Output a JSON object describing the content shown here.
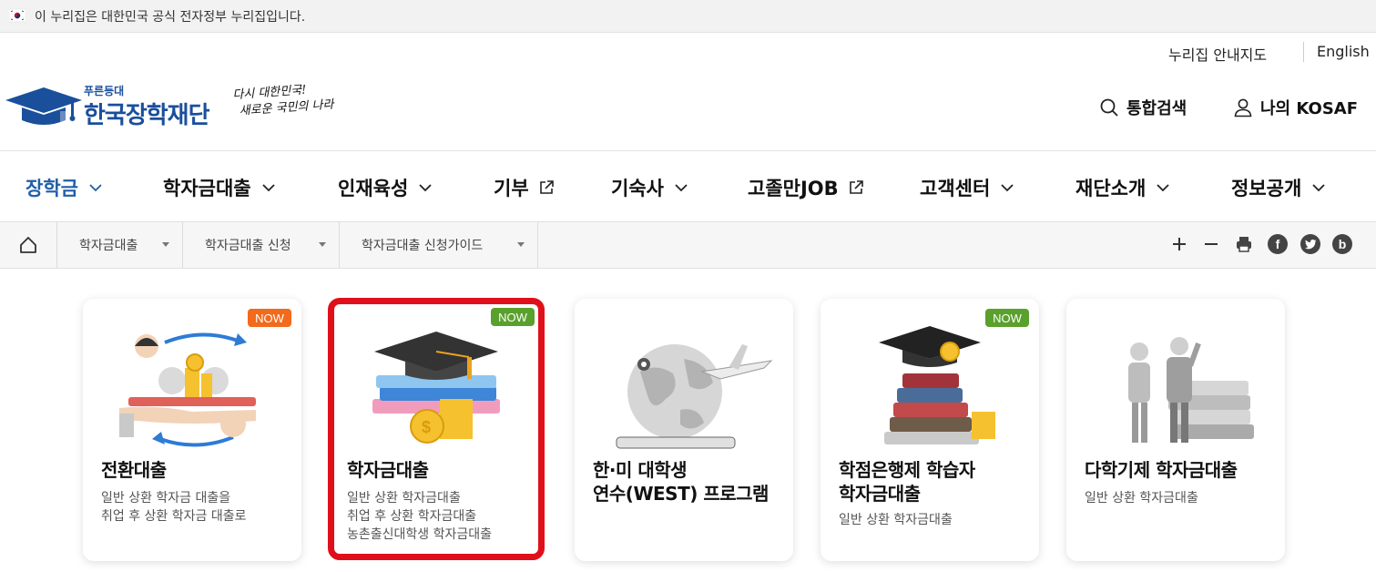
{
  "gov_banner": {
    "text": "이 누리집은 대한민국 공식 전자정부 누리집입니다."
  },
  "utility": {
    "sitemap": "누리집 안내지도",
    "english": "English"
  },
  "logo": {
    "pre": "푸른등대",
    "main": "한국장학재단"
  },
  "slogan": {
    "line1": "다시 대한민국!",
    "line2": "새로운 국민의 나라"
  },
  "header": {
    "search": "통합검색",
    "my": "나의 KOSAF"
  },
  "gnb": [
    {
      "label": "장학금",
      "icon": "chevron-down-icon",
      "active": true
    },
    {
      "label": "학자금대출",
      "icon": "chevron-down-icon"
    },
    {
      "label": "인재육성",
      "icon": "chevron-down-icon"
    },
    {
      "label": "기부",
      "icon": "external-link-icon"
    },
    {
      "label": "기숙사",
      "icon": "chevron-down-icon"
    },
    {
      "label": "고졸만JOB",
      "icon": "external-link-icon"
    },
    {
      "label": "고객센터",
      "icon": "chevron-down-icon"
    },
    {
      "label": "재단소개",
      "icon": "chevron-down-icon"
    },
    {
      "label": "정보공개",
      "icon": "chevron-down-icon"
    }
  ],
  "breadcrumb": [
    "학자금대출",
    "학자금대출 신청",
    "학자금대출 신청가이드"
  ],
  "tools": {
    "facebook": "f",
    "blog": "b"
  },
  "cards": [
    {
      "title": "전환대출",
      "desc": [
        "일반 상환 학자금 대출을",
        "취업 후 상환 학자금 대출로"
      ],
      "badge": "NOW",
      "badge_color": "#f26a1b"
    },
    {
      "title": "학자금대출",
      "desc": [
        "일반 상환 학자금대출",
        "취업 후 상환 학자금대출",
        "농촌출신대학생 학자금대출"
      ],
      "badge": "NOW",
      "badge_color": "#5aa02c",
      "selected": true
    },
    {
      "title": "한·미 대학생",
      "title2": "연수(WEST) 프로그램",
      "desc": []
    },
    {
      "title": "학점은행제 학습자",
      "title2": "학자금대출",
      "desc": [
        "일반 상환 학자금대출"
      ],
      "badge": "NOW",
      "badge_color": "#5aa02c"
    },
    {
      "title": "다학기제 학자금대출",
      "desc": [
        "일반 상환 학자금대출"
      ]
    }
  ],
  "colors": {
    "brand": "#1a4f9c",
    "active_nav": "#1f5fa8",
    "selection": "#e0101a"
  }
}
